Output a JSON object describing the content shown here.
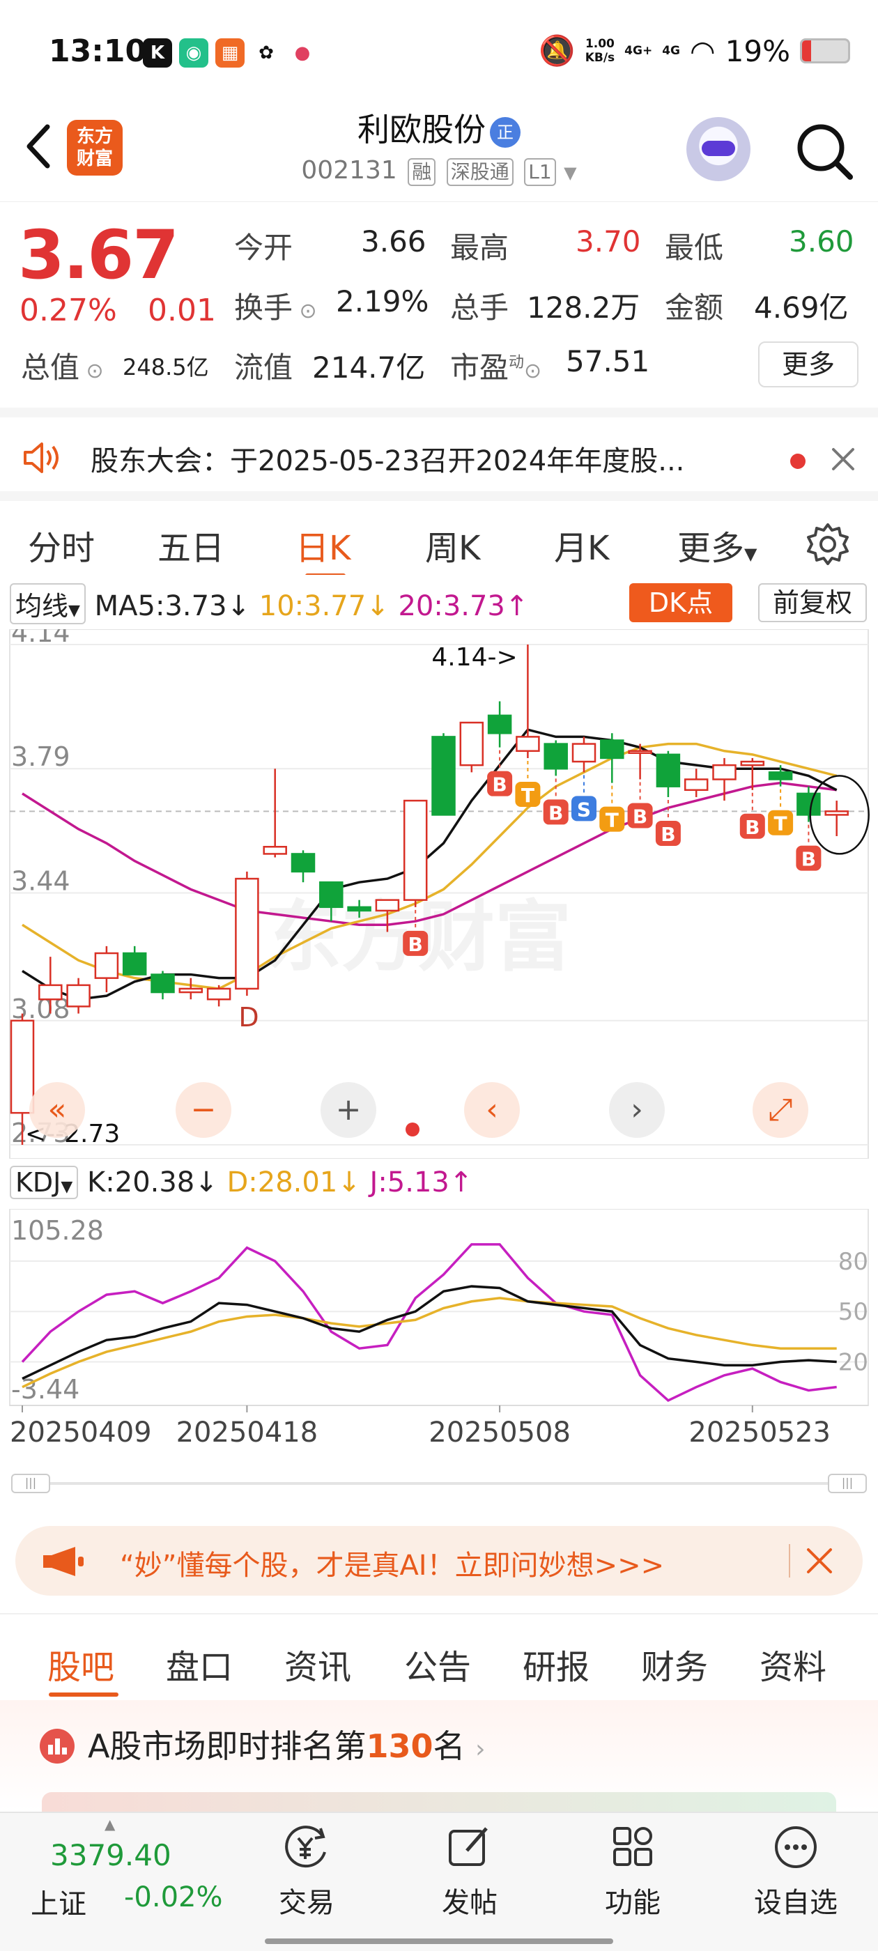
{
  "status_bar": {
    "time": "13:10",
    "net_speed": "1.00",
    "net_unit": "KB/s",
    "sig1": "4G+",
    "sig2": "4G",
    "battery": "19%",
    "battery_level": 0.19,
    "app_icons": [
      "k-app-icon",
      "game-app-icon",
      "shop-app-icon",
      "wechat-icon",
      "camera-app-icon"
    ]
  },
  "header": {
    "logo_text": "东方财富",
    "stock_name": "利欧股份",
    "badge": "正",
    "code": "002131",
    "tags": [
      "融",
      "深股通",
      "L1"
    ]
  },
  "quote": {
    "price": "3.67",
    "change_pct": "0.27%",
    "change_abs": "0.01",
    "open_label": "今开",
    "open": "3.66",
    "high_label": "最高",
    "high": "3.70",
    "low_label": "最低",
    "low": "3.60",
    "turnover_label": "换手",
    "turnover": "2.19%",
    "volume_label": "总手",
    "volume": "128.2万",
    "amount_label": "金额",
    "amount": "4.69亿",
    "total_mv_label": "总值",
    "total_mv": "248.5亿",
    "float_mv_label": "流值",
    "float_mv": "214.7亿",
    "pe_label": "市盈",
    "pe_sup": "动",
    "pe": "57.51",
    "more_label": "更多"
  },
  "notice": {
    "text": "股东大会：于2025-05-23召开2024年年度股..."
  },
  "chart_tabs": [
    "分时",
    "五日",
    "日K",
    "周K",
    "月K",
    "更多"
  ],
  "chart_controls": {
    "ma_select": "均线",
    "ma5": "MA5:3.73",
    "ma10": "10:3.77",
    "ma20": "20:3.73",
    "dk_label": "DK点",
    "fq_label": "前复权",
    "kdj_select": "KDJ",
    "k": "K:20.38",
    "d": "D:28.01",
    "j": "J:5.13"
  },
  "chart_data": {
    "type": "candlestick",
    "y_ticks": [
      "4.14",
      "3.79",
      "3.44",
      "3.08",
      "2.73"
    ],
    "ylim": [
      2.73,
      4.14
    ],
    "high_note": "4.14->",
    "low_note": "<--2.73",
    "kdj_ticks_left": [
      "105.28",
      "-3.44"
    ],
    "kdj_ticks_right": [
      "80",
      "50",
      "20"
    ],
    "kdj_ylim": [
      -3.44,
      105.28
    ],
    "x_labels": [
      "20250409",
      "20250418",
      "20250508",
      "20250523"
    ],
    "x_label_index": [
      0,
      8,
      17,
      26
    ],
    "candles": [
      {
        "o": 2.82,
        "h": 3.1,
        "l": 2.73,
        "c": 3.08
      },
      {
        "o": 3.14,
        "h": 3.26,
        "l": 3.1,
        "c": 3.18
      },
      {
        "o": 3.12,
        "h": 3.2,
        "l": 3.1,
        "c": 3.18
      },
      {
        "o": 3.2,
        "h": 3.29,
        "l": 3.16,
        "c": 3.27
      },
      {
        "o": 3.27,
        "h": 3.29,
        "l": 3.22,
        "c": 3.21
      },
      {
        "o": 3.21,
        "h": 3.22,
        "l": 3.14,
        "c": 3.16
      },
      {
        "o": 3.16,
        "h": 3.2,
        "l": 3.14,
        "c": 3.17
      },
      {
        "o": 3.14,
        "h": 3.18,
        "l": 3.12,
        "c": 3.17
      },
      {
        "o": 3.17,
        "h": 3.5,
        "l": 3.15,
        "c": 3.48
      },
      {
        "o": 3.55,
        "h": 3.79,
        "l": 3.54,
        "c": 3.57
      },
      {
        "o": 3.55,
        "h": 3.56,
        "l": 3.47,
        "c": 3.5
      },
      {
        "o": 3.47,
        "h": 3.47,
        "l": 3.36,
        "c": 3.4
      },
      {
        "o": 3.4,
        "h": 3.42,
        "l": 3.37,
        "c": 3.39
      },
      {
        "o": 3.39,
        "h": 3.42,
        "l": 3.33,
        "c": 3.42
      },
      {
        "o": 3.42,
        "h": 3.7,
        "l": 3.4,
        "c": 3.7
      },
      {
        "o": 3.88,
        "h": 3.89,
        "l": 3.66,
        "c": 3.66
      },
      {
        "o": 3.8,
        "h": 3.92,
        "l": 3.78,
        "c": 3.92
      },
      {
        "o": 3.94,
        "h": 3.98,
        "l": 3.85,
        "c": 3.89
      },
      {
        "o": 3.84,
        "h": 4.14,
        "l": 3.82,
        "c": 3.88
      },
      {
        "o": 3.86,
        "h": 3.87,
        "l": 3.77,
        "c": 3.79
      },
      {
        "o": 3.81,
        "h": 3.88,
        "l": 3.78,
        "c": 3.86
      },
      {
        "o": 3.87,
        "h": 3.89,
        "l": 3.75,
        "c": 3.82
      },
      {
        "o": 3.84,
        "h": 3.86,
        "l": 3.76,
        "c": 3.84
      },
      {
        "o": 3.83,
        "h": 3.84,
        "l": 3.71,
        "c": 3.74
      },
      {
        "o": 3.73,
        "h": 3.79,
        "l": 3.71,
        "c": 3.76
      },
      {
        "o": 3.76,
        "h": 3.82,
        "l": 3.7,
        "c": 3.8
      },
      {
        "o": 3.8,
        "h": 3.82,
        "l": 3.73,
        "c": 3.81
      },
      {
        "o": 3.78,
        "h": 3.8,
        "l": 3.74,
        "c": 3.76
      },
      {
        "o": 3.72,
        "h": 3.74,
        "l": 3.64,
        "c": 3.66
      },
      {
        "o": 3.66,
        "h": 3.7,
        "l": 3.6,
        "c": 3.67
      }
    ],
    "ma5": [
      3.22,
      3.17,
      3.14,
      3.15,
      3.19,
      3.21,
      3.21,
      3.2,
      3.2,
      3.25,
      3.35,
      3.45,
      3.47,
      3.48,
      3.51,
      3.58,
      3.7,
      3.8,
      3.9,
      3.88,
      3.88,
      3.87,
      3.85,
      3.81,
      3.8,
      3.79,
      3.79,
      3.79,
      3.77,
      3.73
    ],
    "ma10": [
      3.35,
      3.3,
      3.25,
      3.22,
      3.2,
      3.19,
      3.18,
      3.17,
      3.21,
      3.26,
      3.3,
      3.34,
      3.36,
      3.38,
      3.41,
      3.45,
      3.52,
      3.6,
      3.68,
      3.74,
      3.78,
      3.82,
      3.85,
      3.86,
      3.86,
      3.84,
      3.83,
      3.81,
      3.79,
      3.77
    ],
    "ma20": [
      3.72,
      3.67,
      3.62,
      3.58,
      3.53,
      3.49,
      3.45,
      3.42,
      3.39,
      3.38,
      3.37,
      3.36,
      3.35,
      3.35,
      3.36,
      3.38,
      3.42,
      3.46,
      3.5,
      3.54,
      3.58,
      3.62,
      3.65,
      3.68,
      3.7,
      3.72,
      3.74,
      3.75,
      3.74,
      3.73
    ],
    "kdj_k": [
      10,
      18,
      26,
      33,
      35,
      40,
      44,
      55,
      54,
      50,
      46,
      40,
      38,
      45,
      50,
      62,
      65,
      64,
      56,
      54,
      52,
      50,
      30,
      22,
      20,
      18,
      18,
      20,
      21,
      20
    ],
    "kdj_d": [
      5,
      13,
      20,
      26,
      30,
      34,
      38,
      44,
      47,
      48,
      46,
      43,
      41,
      43,
      45,
      52,
      56,
      58,
      56,
      55,
      54,
      53,
      46,
      40,
      36,
      33,
      30,
      28,
      28,
      28
    ],
    "kdj_j": [
      20,
      38,
      50,
      60,
      62,
      55,
      62,
      70,
      88,
      80,
      62,
      38,
      28,
      30,
      58,
      72,
      90,
      90,
      70,
      55,
      50,
      48,
      12,
      -3,
      5,
      12,
      16,
      8,
      3,
      5
    ],
    "signals": [
      {
        "i": 8,
        "label": "D",
        "pos": "low",
        "color": "#c0392b"
      },
      {
        "i": 14,
        "label": "B",
        "pos": "low",
        "color": "#e74c3c"
      },
      {
        "i": 17,
        "label": "B",
        "pos": "low",
        "color": "#e74c3c"
      },
      {
        "i": 18,
        "label": "T",
        "pos": "low",
        "color": "#f39c12"
      },
      {
        "i": 19,
        "label": "B",
        "pos": "low",
        "color": "#e74c3c"
      },
      {
        "i": 20,
        "label": "S",
        "pos": "low",
        "color": "#3d7de0"
      },
      {
        "i": 21,
        "label": "T",
        "pos": "low",
        "color": "#f39c12"
      },
      {
        "i": 22,
        "label": "B",
        "pos": "low",
        "color": "#e74c3c"
      },
      {
        "i": 23,
        "label": "B",
        "pos": "low",
        "color": "#e74c3c"
      },
      {
        "i": 26,
        "label": "B",
        "pos": "low",
        "color": "#e74c3c"
      },
      {
        "i": 27,
        "label": "T",
        "pos": "low",
        "color": "#f39c12"
      },
      {
        "i": 28,
        "label": "B",
        "pos": "low",
        "color": "#e74c3c"
      }
    ],
    "watermark": "东方财富"
  },
  "ad": {
    "text": "“妙”懂每个股，才是真AI！立即问妙想>>>"
  },
  "sub_tabs": [
    "股吧",
    "盘口",
    "资讯",
    "公告",
    "研报",
    "财务",
    "资料"
  ],
  "rank": {
    "prefix": "A股市场即时排名第",
    "num": "130",
    "suffix": "名"
  },
  "bottom": {
    "index_value": "3379.40",
    "index_name": "上证",
    "index_change": "-0.02%",
    "nav": [
      "交易",
      "发帖",
      "功能",
      "设自选"
    ]
  }
}
